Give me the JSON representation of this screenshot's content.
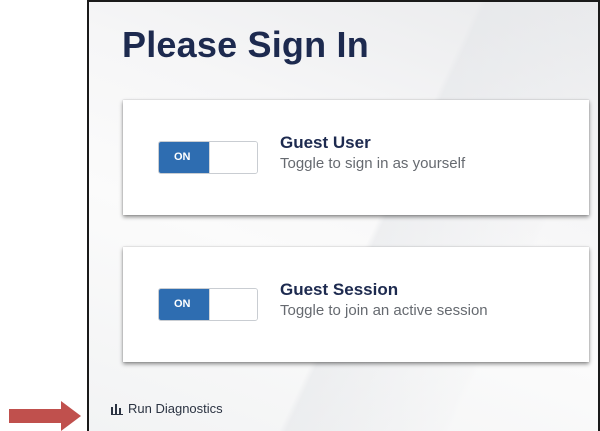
{
  "page": {
    "title": "Please Sign In"
  },
  "options": [
    {
      "toggle_state": "ON",
      "title": "Guest User",
      "description": "Toggle to sign in as yourself"
    },
    {
      "toggle_state": "ON",
      "title": "Guest Session",
      "description": "Toggle to join an active session"
    }
  ],
  "footer": {
    "diagnostics_label": "Run Diagnostics",
    "diagnostics_icon": "bar-chart-icon"
  },
  "annotation": {
    "arrow_icon": "arrow-right-icon",
    "arrow_color": "#c0504d"
  },
  "colors": {
    "title": "#1d2a4f",
    "toggle_on": "#2e6db1",
    "description": "#666a70"
  }
}
